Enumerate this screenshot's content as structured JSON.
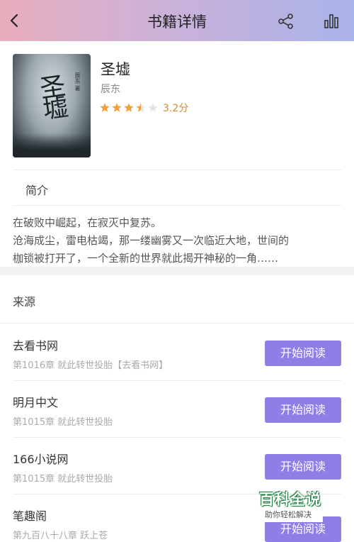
{
  "header": {
    "title": "书籍详情",
    "back_icon": "chevron-left-icon",
    "share_icon": "share-icon",
    "stats_icon": "bar-chart-icon"
  },
  "book": {
    "cover_title": "圣墟",
    "cover_author": "辰东 著",
    "title": "圣墟",
    "author": "辰东",
    "rating_stars": 3.5,
    "rating_max": 5,
    "rating_text": "3.2分",
    "star_color": "#f0a33a"
  },
  "intro": {
    "label": "简介",
    "lines": [
      "在破败中崛起，在寂灭中复苏。",
      " 沧海成尘，雷电枯竭，那一缕幽雾又一次临近大地，世间的",
      "枷锁被打开了，一个全新的世界就此揭开神秘的一角……"
    ]
  },
  "sources": {
    "title": "来源",
    "items": [
      {
        "name": "去看书网",
        "chapter": "第1016章 就此转世投胎【去看书网】",
        "button": "开始阅读"
      },
      {
        "name": "明月中文",
        "chapter": "第1015章 就此转世投胎",
        "button": "开始阅读"
      },
      {
        "name": "166小说网",
        "chapter": "第1015章 就此转世投胎",
        "button": "开始阅读"
      },
      {
        "name": "笔趣阁",
        "chapter": "第九百八十八章 跃上苍",
        "button": "开始阅读"
      }
    ]
  },
  "watermark": {
    "title": "百科全说",
    "subtitle": "助你轻松解决"
  },
  "colors": {
    "accent": "#8f7ee6",
    "header_start": "#e8aebd",
    "header_end": "#a9b3ea",
    "rating_text": "#d9892a"
  }
}
